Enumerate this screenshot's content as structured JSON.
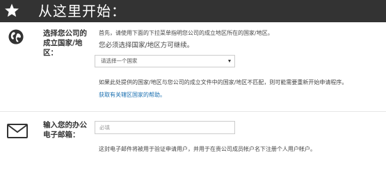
{
  "header": {
    "title": "从这里开始：",
    "icon": "star-icon"
  },
  "section1": {
    "icon": "globe-icon",
    "label": [
      "选择您公司的",
      "成立国家/地",
      "区："
    ],
    "intro": "首先，请使用下面的下拉菜单指明您公司的成立地区所在的国家/地区。",
    "requirement": "您必须选择国家/地区方可继续。",
    "select_value": "请选择一个国家",
    "note": "如果此处提供的国家/地区与您公司的成立文件中的国家/地区不匹配，则可能需要重新开始申请程序。",
    "help_link": "获取有关辖区国家的帮助。"
  },
  "section2": {
    "icon": "envelope-icon",
    "label": [
      "输入您的办公",
      "电子邮箱："
    ],
    "placeholder": "必填",
    "note": "这封电子邮件将被用于验证申请用户，并用于在贵公司成员帐户名下注册个人用户帐户。"
  }
}
